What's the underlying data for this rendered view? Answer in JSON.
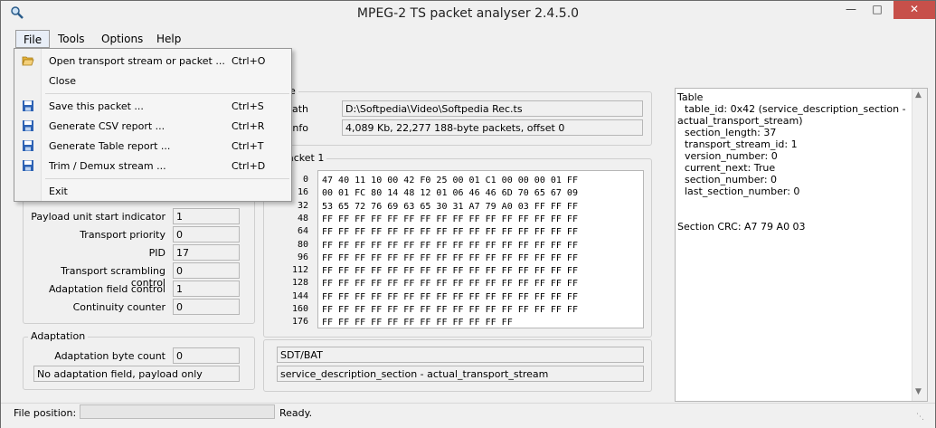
{
  "window": {
    "title": "MPEG-2 TS packet analyser 2.4.5.0"
  },
  "menubar": {
    "file": "File",
    "tools": "Tools",
    "options": "Options",
    "help": "Help"
  },
  "file_menu": [
    {
      "label": "Open transport stream or packet ...",
      "shortcut": "Ctrl+O",
      "icon": "folder-open-icon"
    },
    {
      "label": "Close",
      "shortcut": "",
      "icon": ""
    },
    {
      "label": "Save this packet ...",
      "shortcut": "Ctrl+S",
      "icon": "floppy-disk-icon"
    },
    {
      "label": "Generate CSV report ...",
      "shortcut": "Ctrl+R",
      "icon": "floppy-disk-icon"
    },
    {
      "label": "Generate Table report ...",
      "shortcut": "Ctrl+T",
      "icon": "floppy-disk-icon"
    },
    {
      "label": "Trim / Demux stream ...",
      "shortcut": "Ctrl+D",
      "icon": "floppy-disk-icon"
    },
    {
      "label": "Exit",
      "shortcut": "",
      "icon": ""
    }
  ],
  "file_group": {
    "label": "e",
    "path_label": "Path",
    "path_value": "D:\\Softpedia\\Video\\Softpedia Rec.ts",
    "info_label": "Info",
    "info_value": "4,089 Kb, 22,277 188-byte packets, offset 0"
  },
  "header_fields": [
    {
      "label": "Payload unit start indicator",
      "value": "1"
    },
    {
      "label": "Transport priority",
      "value": "0"
    },
    {
      "label": "PID",
      "value": "17"
    },
    {
      "label": "Transport scrambling control",
      "value": "0"
    },
    {
      "label": "Adaptation field control",
      "value": "1"
    },
    {
      "label": "Continuity counter",
      "value": "0"
    }
  ],
  "adaptation": {
    "group_label": "Adaptation",
    "byte_count_label": "Adaptation byte count",
    "byte_count_value": "0",
    "description": "No adaptation field, payload only"
  },
  "packet": {
    "group_label": "acket 1",
    "rows": [
      {
        "offset": "0",
        "hex": "47 40 11 10 00 42 F0 25 00 01 C1 00 00 00 01 FF"
      },
      {
        "offset": "16",
        "hex": "00 01 FC 80 14 48 12 01 06 46 46 6D 70 65 67 09"
      },
      {
        "offset": "32",
        "hex": "53 65 72 76 69 63 65 30 31 A7 79 A0 03 FF FF FF"
      },
      {
        "offset": "48",
        "hex": "FF FF FF FF FF FF FF FF FF FF FF FF FF FF FF FF"
      },
      {
        "offset": "64",
        "hex": "FF FF FF FF FF FF FF FF FF FF FF FF FF FF FF FF"
      },
      {
        "offset": "80",
        "hex": "FF FF FF FF FF FF FF FF FF FF FF FF FF FF FF FF"
      },
      {
        "offset": "96",
        "hex": "FF FF FF FF FF FF FF FF FF FF FF FF FF FF FF FF"
      },
      {
        "offset": "112",
        "hex": "FF FF FF FF FF FF FF FF FF FF FF FF FF FF FF FF"
      },
      {
        "offset": "128",
        "hex": "FF FF FF FF FF FF FF FF FF FF FF FF FF FF FF FF"
      },
      {
        "offset": "144",
        "hex": "FF FF FF FF FF FF FF FF FF FF FF FF FF FF FF FF"
      },
      {
        "offset": "160",
        "hex": "FF FF FF FF FF FF FF FF FF FF FF FF FF FF FF FF"
      },
      {
        "offset": "176",
        "hex": "FF FF FF FF FF FF FF FF FF FF FF FF"
      }
    ]
  },
  "section": {
    "type": "SDT/BAT",
    "name": "service_description_section - actual_transport_stream"
  },
  "table_view": {
    "lines": [
      "Table",
      "table_id: 0x42 (service_description_section -",
      "actual_transport_stream)",
      "section_length: 37",
      "transport_stream_id: 1",
      "version_number: 0",
      "current_next: True",
      "section_number: 0",
      "last_section_number: 0",
      "Section CRC: A7 79 A0 03"
    ]
  },
  "statusbar": {
    "file_position_label": "File position:",
    "status": "Ready."
  },
  "colors": {
    "close_button": "#c7504a",
    "menu_highlight": "#e8eef7"
  }
}
